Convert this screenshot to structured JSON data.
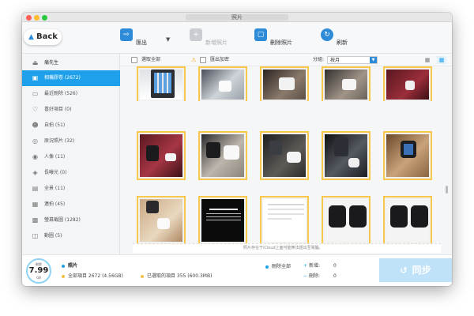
{
  "window": {
    "title": "照片"
  },
  "toolbar": {
    "back_label": "Back",
    "items": [
      {
        "label": "匯出",
        "icon": "export-icon",
        "enabled": true
      },
      {
        "label": "新增照片",
        "icon": "add-photo-icon",
        "enabled": false
      },
      {
        "label": "刪除照片",
        "icon": "delete-photo-icon",
        "enabled": true
      },
      {
        "label": "刷新",
        "icon": "refresh-icon",
        "enabled": true
      }
    ]
  },
  "sidebar": {
    "device_name": "痛先生",
    "items": [
      {
        "label": "相機膠卷 (2672)",
        "icon": "camera-roll-icon",
        "active": true
      },
      {
        "label": "最近刪除 (526)",
        "icon": "trash-icon",
        "active": false
      },
      {
        "label": "喜好項目 (0)",
        "icon": "heart-icon",
        "active": false
      },
      {
        "label": "自拍 (51)",
        "icon": "selfie-icon",
        "active": false
      },
      {
        "label": "原況照片 (32)",
        "icon": "live-photo-icon",
        "active": false
      },
      {
        "label": "人像 (11)",
        "icon": "portrait-icon",
        "active": false
      },
      {
        "label": "長曝光 (0)",
        "icon": "long-exposure-icon",
        "active": false
      },
      {
        "label": "全景 (11)",
        "icon": "panorama-icon",
        "active": false
      },
      {
        "label": "連拍 (45)",
        "icon": "burst-icon",
        "active": false
      },
      {
        "label": "螢幕截圖 (1282)",
        "icon": "screenshot-icon",
        "active": false
      },
      {
        "label": "動圖 (5)",
        "icon": "animated-icon",
        "active": false
      }
    ]
  },
  "filterbar": {
    "select_all": "選取全部",
    "export_hint": "匯出加密",
    "sort_label": "分組:",
    "sort_value": "按月"
  },
  "grid_note": "照片存在于iCloud上面可能無法匯出至電腦。",
  "footer": {
    "gauge_top": "剩餘",
    "gauge_value": "7.99",
    "gauge_unit": "GB",
    "category": "照片",
    "all_items": "全部項目 2672 (4.56GB)",
    "selected_items": "已選取的項目 355 (600.3MB)",
    "delete_all": "刪除全部",
    "added_label": "新增:",
    "added_value": "0",
    "deleted_label": "刪除:",
    "deleted_value": "0",
    "sync_label": "同步"
  },
  "colors": {
    "accent": "#1ea1ea",
    "thumb_border": "#f7c84b",
    "sync_button": "#bfe2f8"
  }
}
